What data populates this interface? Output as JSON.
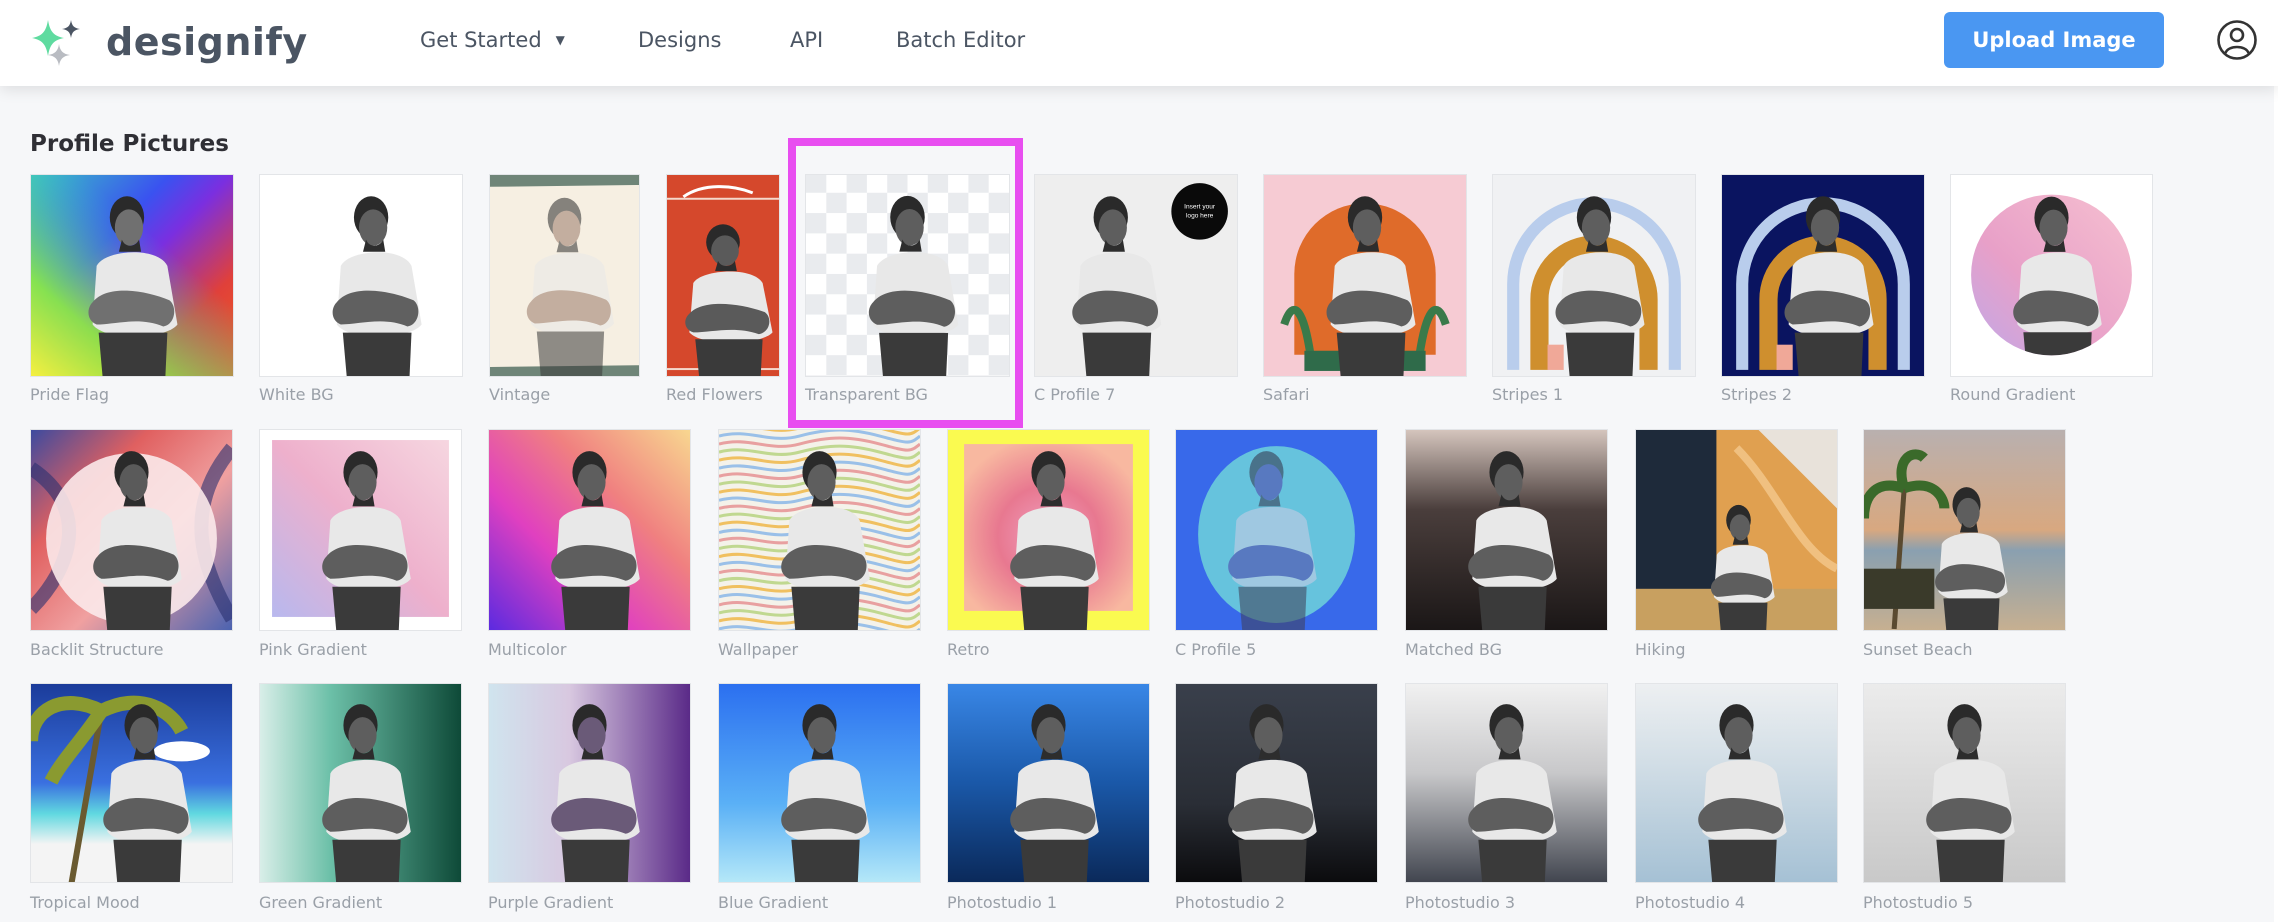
{
  "header": {
    "brand": "designify",
    "nav": [
      {
        "label": "Get Started",
        "has_dropdown": true
      },
      {
        "label": "Designs"
      },
      {
        "label": "API"
      },
      {
        "label": "Batch Editor"
      }
    ],
    "upload_button": "Upload Image",
    "account_icon": "user-circle-icon"
  },
  "colors": {
    "brand_green": "#5fdba0",
    "brand_dark": "#4b5563",
    "brand_gray": "#b9bcc2",
    "upload_blue": "#4a97f2",
    "selection_magenta": "#e84ef0",
    "page_bg": "#f6f7f9"
  },
  "section": {
    "title": "Profile Pictures",
    "selected": "Transparent BG",
    "rows": [
      [
        {
          "label": "Pride Flag",
          "style": "pride"
        },
        {
          "label": "White BG",
          "style": "white"
        },
        {
          "label": "Vintage",
          "style": "vintage"
        },
        {
          "label": "Red Flowers",
          "style": "redflowers"
        },
        {
          "label": "Transparent BG",
          "style": "transparent"
        },
        {
          "label": "C Profile 7",
          "style": "cprofile7",
          "badge": "Insert your logo here"
        },
        {
          "label": "Safari",
          "style": "safari"
        },
        {
          "label": "Stripes 1",
          "style": "stripes1"
        },
        {
          "label": "Stripes 2",
          "style": "stripes2"
        },
        {
          "label": "Round Gradient",
          "style": "roundgradient"
        }
      ],
      [
        {
          "label": "Backlit Structure",
          "style": "backlit"
        },
        {
          "label": "Pink Gradient",
          "style": "pinkgradient"
        },
        {
          "label": "Multicolor",
          "style": "multicolor"
        },
        {
          "label": "Wallpaper",
          "style": "wallpaper"
        },
        {
          "label": "Retro",
          "style": "retro"
        },
        {
          "label": "C Profile 5",
          "style": "cprofile5"
        },
        {
          "label": "Matched BG",
          "style": "matched"
        },
        {
          "label": "Hiking",
          "style": "hiking"
        },
        {
          "label": "Sunset Beach",
          "style": "sunset"
        }
      ],
      [
        {
          "label": "Tropical Mood",
          "style": "tropical"
        },
        {
          "label": "Green Gradient",
          "style": "greengradient"
        },
        {
          "label": "Purple Gradient",
          "style": "purplegradient"
        },
        {
          "label": "Blue Gradient",
          "style": "bluegradient"
        },
        {
          "label": "Photostudio 1",
          "style": "photo1"
        },
        {
          "label": "Photostudio 2",
          "style": "photo2"
        },
        {
          "label": "Photostudio 3",
          "style": "photo3"
        },
        {
          "label": "Photostudio 4",
          "style": "photo4"
        },
        {
          "label": "Photostudio 5",
          "style": "photo5"
        }
      ]
    ]
  }
}
